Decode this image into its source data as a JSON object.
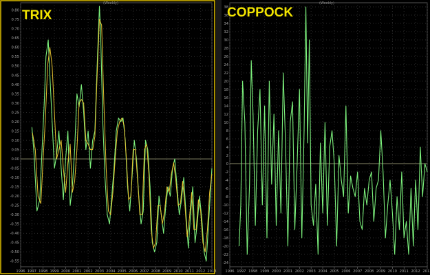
{
  "colors": {
    "background": "#000000",
    "title": "#f2e400",
    "line_primary": "#7cf07c",
    "line_signal": "#e6c230",
    "zero_line": "#8a8a6a",
    "frame": "#555555",
    "highlight_border": "#e0c000"
  },
  "chart_data": [
    {
      "type": "line",
      "title": "TRIX",
      "period_label": "(Weekly)",
      "x_ticks": [
        "1996",
        "1997",
        "1998",
        "1999",
        "2000",
        "2001",
        "2002",
        "2003",
        "2004",
        "2005",
        "2006",
        "2007",
        "2008",
        "2009",
        "2010",
        "2011",
        "2012",
        "2013"
      ],
      "xlim": [
        1996.0,
        2013.0
      ],
      "ylim": [
        -0.58,
        0.84
      ],
      "y_ticks": [
        "-0.55",
        "-0.50",
        "-0.45",
        "-0.40",
        "-0.35",
        "-0.30",
        "-0.25",
        "-0.20",
        "-0.15",
        "-0.10",
        "-0.05",
        "0.00",
        "0.05",
        "0.10",
        "0.15",
        "0.20",
        "0.25",
        "0.30",
        "0.35",
        "0.40",
        "0.45",
        "0.50",
        "0.55",
        "0.60",
        "0.65",
        "0.70",
        "0.75",
        "0.80"
      ],
      "series": [
        {
          "role": "primary",
          "x": [
            1997.0,
            1997.2,
            1997.45,
            1997.7,
            1997.9,
            1998.1,
            1998.25,
            1998.45,
            1998.6,
            1998.8,
            1999.0,
            1999.2,
            1999.4,
            1999.6,
            1999.8,
            2000.0,
            2000.2,
            2000.4,
            2000.6,
            2000.8,
            2001.0,
            2001.2,
            2001.4,
            2001.6,
            2001.8,
            2002.0,
            2002.2,
            2002.4,
            2002.6,
            2002.8,
            2003.0,
            2003.1,
            2003.3,
            2003.5,
            2003.7,
            2003.9,
            2004.1,
            2004.3,
            2004.5,
            2004.7,
            2004.9,
            2005.1,
            2005.3,
            2005.5,
            2005.7,
            2005.9,
            2006.1,
            2006.3,
            2006.5,
            2006.7,
            2006.9,
            2007.1,
            2007.3,
            2007.5,
            2007.7,
            2007.9,
            2008.1,
            2008.3,
            2008.5,
            2008.7,
            2008.9,
            2009.1,
            2009.3,
            2009.5,
            2009.7,
            2009.9,
            2010.1,
            2010.3,
            2010.5,
            2010.7,
            2010.9,
            2011.1,
            2011.3,
            2011.5,
            2011.7,
            2011.9,
            2012.1,
            2012.3,
            2012.5,
            2012.7,
            2012.9,
            2013.0
          ],
          "y": [
            0.17,
            0.02,
            -0.28,
            -0.22,
            0.05,
            0.3,
            0.55,
            0.64,
            0.45,
            0.2,
            -0.05,
            0.02,
            0.15,
            -0.05,
            -0.22,
            0.0,
            0.15,
            -0.25,
            -0.15,
            0.05,
            0.35,
            0.28,
            0.4,
            0.25,
            0.05,
            0.15,
            -0.05,
            0.1,
            0.15,
            0.5,
            0.82,
            0.7,
            0.2,
            -0.1,
            -0.3,
            -0.35,
            -0.2,
            -0.05,
            0.15,
            0.22,
            0.2,
            0.22,
            0.1,
            -0.15,
            -0.28,
            -0.1,
            0.1,
            0.0,
            -0.2,
            -0.35,
            -0.28,
            0.1,
            0.05,
            -0.15,
            -0.45,
            -0.5,
            -0.45,
            -0.2,
            -0.3,
            -0.4,
            -0.25,
            -0.15,
            -0.2,
            -0.05,
            0.0,
            -0.15,
            -0.3,
            -0.22,
            -0.1,
            -0.3,
            -0.48,
            -0.3,
            -0.15,
            -0.45,
            -0.35,
            -0.2,
            -0.32,
            -0.5,
            -0.55,
            -0.35,
            -0.15,
            -0.05
          ]
        },
        {
          "role": "signal",
          "x": [
            1997.05,
            1997.3,
            1997.55,
            1997.8,
            1998.0,
            1998.2,
            1998.4,
            1998.6,
            1998.8,
            1999.0,
            1999.2,
            1999.4,
            1999.6,
            1999.8,
            2000.0,
            2000.2,
            2000.4,
            2000.6,
            2000.8,
            2001.0,
            2001.2,
            2001.4,
            2001.6,
            2001.8,
            2002.0,
            2002.2,
            2002.4,
            2002.6,
            2002.8,
            2003.0,
            2003.2,
            2003.4,
            2003.6,
            2003.8,
            2004.0,
            2004.2,
            2004.4,
            2004.6,
            2004.8,
            2005.0,
            2005.2,
            2005.4,
            2005.6,
            2005.8,
            2006.0,
            2006.2,
            2006.4,
            2006.6,
            2006.8,
            2007.0,
            2007.2,
            2007.4,
            2007.6,
            2007.8,
            2008.0,
            2008.2,
            2008.4,
            2008.6,
            2008.8,
            2009.0,
            2009.2,
            2009.4,
            2009.6,
            2009.8,
            2010.0,
            2010.2,
            2010.4,
            2010.6,
            2010.8,
            2011.0,
            2011.2,
            2011.4,
            2011.6,
            2011.8,
            2012.0,
            2012.2,
            2012.4,
            2012.6,
            2012.8,
            2013.0
          ],
          "y": [
            0.14,
            0.05,
            -0.2,
            -0.24,
            0.0,
            0.22,
            0.5,
            0.6,
            0.5,
            0.25,
            0.0,
            0.05,
            0.1,
            -0.05,
            -0.18,
            -0.02,
            0.08,
            -0.18,
            -0.12,
            0.05,
            0.3,
            0.32,
            0.3,
            0.1,
            0.08,
            0.05,
            0.05,
            0.12,
            0.45,
            0.75,
            0.72,
            0.3,
            -0.05,
            -0.28,
            -0.3,
            -0.18,
            0.0,
            0.15,
            0.2,
            0.22,
            0.18,
            0.0,
            -0.22,
            -0.2,
            0.05,
            0.05,
            -0.12,
            -0.3,
            -0.3,
            0.05,
            0.08,
            -0.08,
            -0.38,
            -0.48,
            -0.45,
            -0.25,
            -0.25,
            -0.35,
            -0.28,
            -0.15,
            -0.18,
            -0.08,
            -0.02,
            -0.12,
            -0.25,
            -0.24,
            -0.12,
            -0.25,
            -0.42,
            -0.32,
            -0.18,
            -0.38,
            -0.38,
            -0.22,
            -0.28,
            -0.45,
            -0.5,
            -0.38,
            -0.18,
            -0.08
          ]
        }
      ]
    },
    {
      "type": "line",
      "title": "COPPOCK",
      "period_label": "(Weekly)",
      "x_ticks": [
        "1996",
        "1997",
        "1998",
        "1999",
        "2000",
        "2001",
        "2002",
        "2003",
        "2004",
        "2005",
        "2006",
        "2007",
        "2008",
        "2009",
        "2010",
        "2011",
        "2012",
        "2013"
      ],
      "xlim": [
        1996.0,
        2013.0
      ],
      "ylim": [
        -25.0,
        39.0
      ],
      "y_ticks": [
        "-24",
        "-22",
        "-20",
        "-18",
        "-16",
        "-14",
        "-12",
        "-10",
        "-8",
        "-6",
        "-4",
        "-2",
        "0",
        "2",
        "4",
        "6",
        "8",
        "10",
        "12",
        "14",
        "16",
        "18",
        "20",
        "22",
        "24",
        "26",
        "28",
        "30",
        "32",
        "34",
        "36",
        "38"
      ],
      "series": [
        {
          "role": "primary",
          "x": [
            1996.8,
            1996.95,
            1997.1,
            1997.3,
            1997.5,
            1997.7,
            1997.85,
            1998.0,
            1998.2,
            1998.4,
            1998.6,
            1998.8,
            1999.0,
            1999.2,
            1999.4,
            1999.6,
            1999.8,
            2000.0,
            2000.2,
            2000.4,
            2000.6,
            2000.8,
            2001.0,
            2001.2,
            2001.4,
            2001.6,
            2001.8,
            2002.0,
            2002.2,
            2002.4,
            2002.55,
            2002.7,
            2002.85,
            2003.0,
            2003.2,
            2003.4,
            2003.6,
            2003.8,
            2004.0,
            2004.2,
            2004.4,
            2004.6,
            2004.8,
            2005.0,
            2005.2,
            2005.4,
            2005.6,
            2005.8,
            2006.0,
            2006.2,
            2006.4,
            2006.6,
            2006.8,
            2007.0,
            2007.2,
            2007.4,
            2007.6,
            2007.8,
            2008.0,
            2008.2,
            2008.4,
            2008.6,
            2008.8,
            2009.0,
            2009.2,
            2009.4,
            2009.6,
            2009.8,
            2010.0,
            2010.2,
            2010.4,
            2010.6,
            2010.8,
            2011.0,
            2011.2,
            2011.4,
            2011.6,
            2011.8,
            2012.0,
            2012.2,
            2012.4,
            2012.6,
            2012.8,
            2013.0
          ],
          "y": [
            -20,
            -10,
            20,
            10,
            -22,
            -5,
            25,
            12,
            -15,
            8,
            18,
            -10,
            14,
            -18,
            20,
            -5,
            12,
            -15,
            8,
            -12,
            22,
            5,
            -20,
            10,
            15,
            -16,
            0,
            18,
            -18,
            8,
            38,
            5,
            30,
            -10,
            -15,
            -5,
            -22,
            5,
            -12,
            10,
            -15,
            4,
            8,
            0,
            -20,
            2,
            -4,
            -8,
            14,
            -12,
            -3,
            -6,
            -8,
            -2,
            -14,
            -16,
            -6,
            -10,
            -4,
            -2,
            -14,
            -6,
            -4,
            8,
            -2,
            -18,
            -10,
            -4,
            -12,
            -22,
            -8,
            -16,
            -2,
            -18,
            -14,
            -22,
            -6,
            -20,
            -4,
            -16,
            4,
            -8,
            0,
            -2
          ]
        }
      ]
    }
  ]
}
